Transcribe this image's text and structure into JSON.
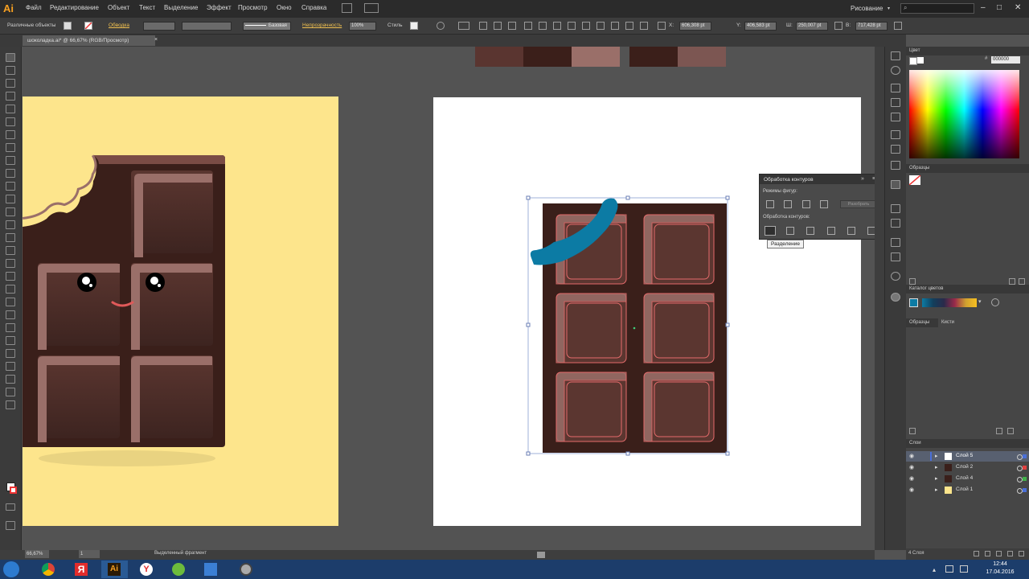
{
  "app": {
    "logo": "Ai",
    "menu": [
      "Файл",
      "Редактирование",
      "Объект",
      "Текст",
      "Выделение",
      "Эффект",
      "Просмотр",
      "Окно",
      "Справка"
    ],
    "workspace": "Рисование",
    "search_placeholder": "",
    "window_controls": [
      "–",
      "□",
      "✕"
    ]
  },
  "control_bar": {
    "selection_label": "Различные объекты",
    "stroke_label": "Обводка",
    "stroke_style": "Базовая",
    "opacity_label": "Непрозрачность",
    "opacity_value": "100%",
    "style_label": "Стиль",
    "x_value": "606,308 pt",
    "y_value": "406,583 pt",
    "w_value": "250,007 pt",
    "h_value": "717,428 pt"
  },
  "document": {
    "tab_title": "шоколадка.ai* @ 66,67% (RGB/Просмотр)",
    "close": "×"
  },
  "pathfinder": {
    "title": "Обработка контуров",
    "shape_modes_label": "Режимы фигур:",
    "expand_button": "Разобрать",
    "pathfinders_label": "Обработка контуров:",
    "tooltip": "Разделение"
  },
  "right_panel": {
    "color_tab": "Цвет",
    "hex_value": "000000",
    "swatches_tab": "Образцы",
    "brushes_tab": "Кисти",
    "symbols_tab": "Библиотеки",
    "color_guide_tab": "Каталог цветов",
    "graphic_styles_tab": "Образцы",
    "layers_tab": "Слои",
    "layers": [
      {
        "name": "Слой 5",
        "color": "#4a6fd8"
      },
      {
        "name": "Слой 2",
        "color": "#e04040"
      },
      {
        "name": "Слой 4",
        "color": "#41b04a"
      },
      {
        "name": "Слой 1",
        "color": "#4a6fd8"
      }
    ],
    "layers_count": "4 Слоя"
  },
  "status_bar": {
    "zoom": "66,67%",
    "page": "1",
    "status_text": "Выделенный фрагмент"
  },
  "taskbar": {
    "time": "12:44",
    "date": "17.04.2016"
  },
  "colors": {
    "chocolate_dark": "#3a1f1a",
    "chocolate_mid": "#5b3630",
    "chocolate_light": "#9a6f69",
    "artboard_bg": "#fde58c",
    "bite_blue": "#0c7ba4",
    "accent": "#f7a021"
  }
}
